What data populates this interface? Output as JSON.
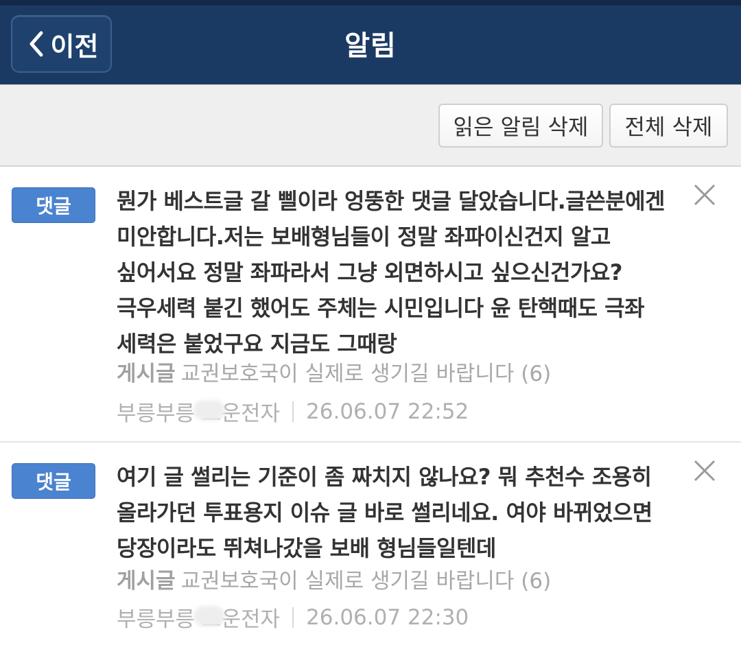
{
  "header": {
    "back_label": "이전",
    "title": "알림",
    "bg_color": "#1b3a63"
  },
  "toolbar": {
    "delete_read_label": "읽은 알림 삭제",
    "delete_all_label": "전체 삭제"
  },
  "notifications": [
    {
      "badge": "댓글",
      "text": "뭔가 베스트글 갈 삘이라 엉뚱한 댓글 달았습니다.글쓴분에겐 미안합니다.저는 보배형님들이 정말 좌파이신건지 알고 싶어서요 정말 좌파라서 그냥 외면하시고 싶으신건가요? 극우세력 붙긴 했어도 주체는 시민입니다 윤 탄핵때도 극좌 세력은 붙었구요 지금도 그때랑",
      "post_label": "게시글",
      "post_title": "교권보호국이 실제로 생기길 바랍니다 (6)",
      "author": "부릉부릉 보운전자",
      "datetime": "26.06.07 22:52"
    },
    {
      "badge": "댓글",
      "text": "여기 글 썰리는 기준이 좀 짜치지 않나요? 뭐 추천수 조용히 올라가던 투표용지 이슈 글 바로 썰리네요. 여야 바뀌었으면 당장이라도 뛰쳐나갔을 보배 형님들일텐데",
      "post_label": "게시글",
      "post_title": "교권보호국이 실제로 생기길 바랍니다 (6)",
      "author": "부릉부릉 보운전자",
      "datetime": "26.06.07 22:30"
    }
  ],
  "icons": {
    "back": "chevron-left-icon",
    "close": "close-icon"
  },
  "colors": {
    "badge": "#4a83cf",
    "text": "#333333",
    "muted": "#a8a8a8"
  }
}
